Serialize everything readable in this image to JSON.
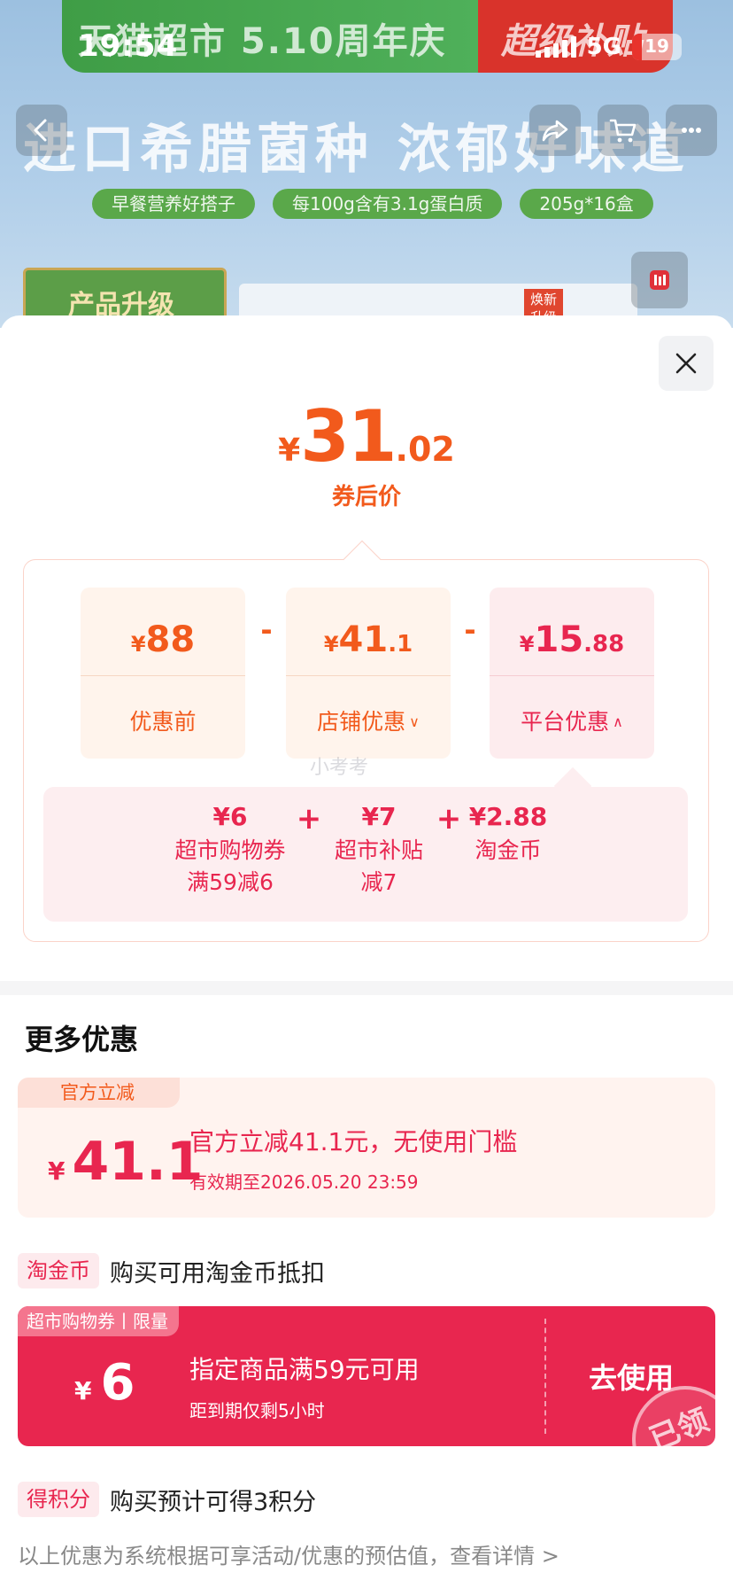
{
  "status_bar": {
    "time": "19:54",
    "network": "5G",
    "battery": "19",
    "battery_level": 0.19
  },
  "backdrop": {
    "banner_left": "天猫超市 5.10周年庆",
    "banner_right": "超级补贴",
    "headline": "进口希腊菌种 浓郁好味道",
    "pills": [
      "早餐营养好搭子",
      "每100g含有3.1g蛋白质",
      "205g*16盒"
    ],
    "upgrade_badge": "产品升级",
    "new_tag": "焕新升级"
  },
  "price": {
    "currency": "¥",
    "integer": "31",
    "decimal": ".02",
    "caption": "券后价"
  },
  "breakdown": {
    "original": {
      "currency": "¥",
      "integer": "88",
      "decimal": "",
      "label": "优惠前"
    },
    "op1": "-",
    "shop": {
      "currency": "¥",
      "integer": "41",
      "decimal": ".1",
      "label": "店铺优惠"
    },
    "op2": "-",
    "platform": {
      "currency": "¥",
      "integer": "15",
      "decimal": ".88",
      "label": "平台优惠"
    },
    "platform_items": [
      {
        "value": "¥6",
        "line1": "超市购物券",
        "line2": "满59减6"
      },
      {
        "value": "¥7",
        "line1": "超市补贴",
        "line2": "减7"
      },
      {
        "value": "¥2.88",
        "line1": "淘金币",
        "line2": ""
      }
    ],
    "plus": "+"
  },
  "watermark": "小考考",
  "more": {
    "title": "更多优惠",
    "official_off": {
      "tag": "官方立减",
      "currency": "¥",
      "amount": "41.1",
      "title": "官方立减41.1元，无使用门槛",
      "subtitle": "有效期至2026.05.20 23:59"
    },
    "taojin": {
      "chip": "淘金币",
      "text": "购买可用淘金币抵扣"
    },
    "coupon": {
      "tag": "超市购物券丨限量",
      "currency": "¥",
      "amount": "6",
      "title": "指定商品满59元可用",
      "subtitle": "距到期仅剩5小时",
      "action": "去使用",
      "stamp": "已领"
    },
    "points": {
      "chip": "得积分",
      "text": "购买预计可得3积分"
    }
  },
  "footer_note": "以上优惠为系统根据可享活动/优惠的预估值，查看详情 >",
  "colors": {
    "orange": "#f25a1c",
    "red": "#e8264f",
    "coupon_red": "#e8264f"
  }
}
